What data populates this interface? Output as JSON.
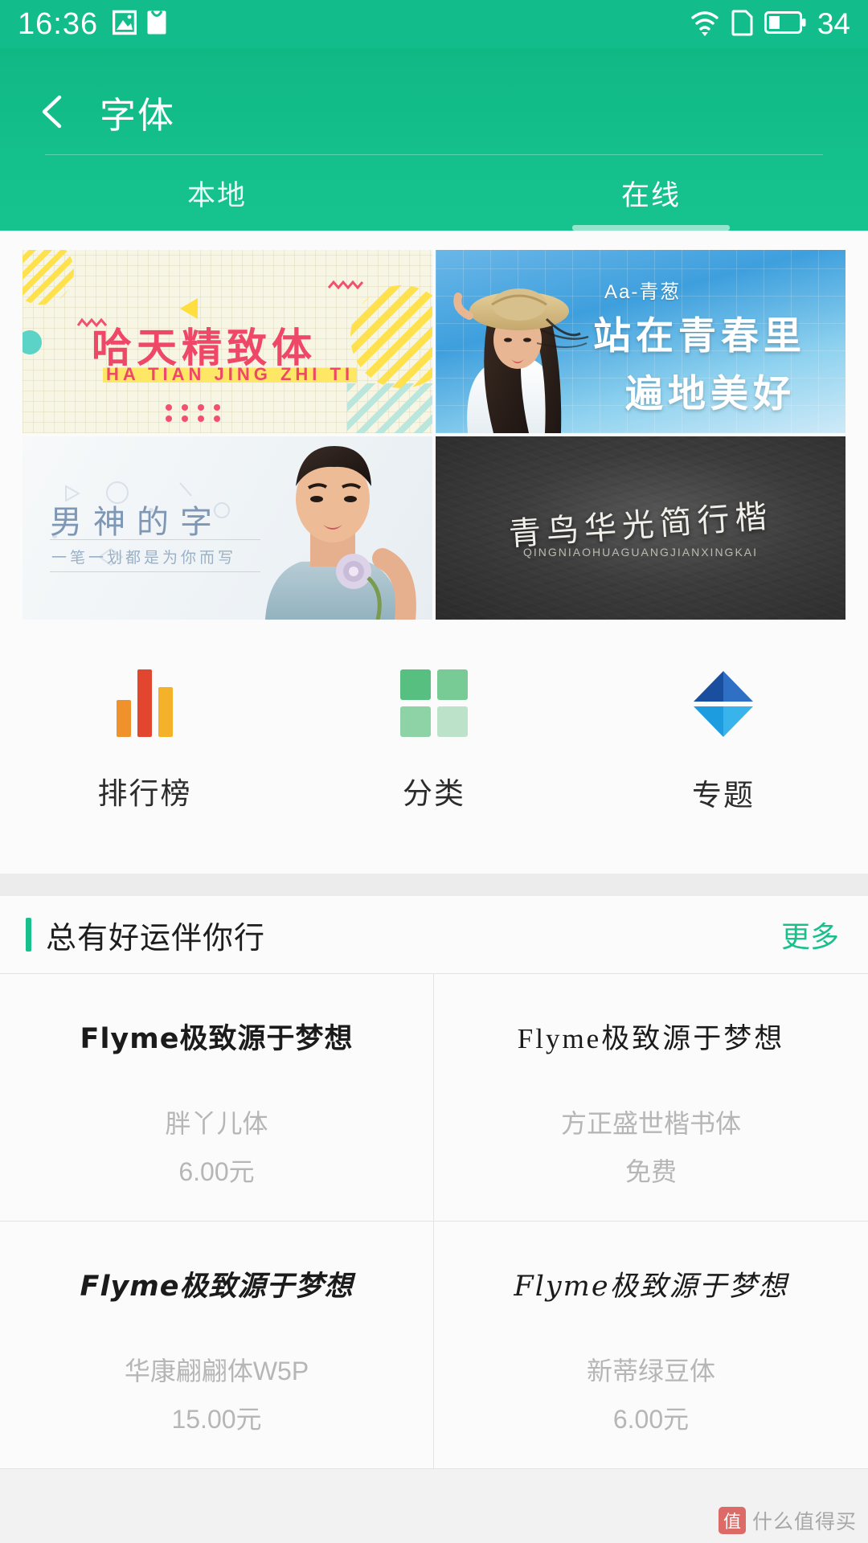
{
  "statusbar": {
    "time": "16:36",
    "icons": [
      "image-icon",
      "mail-icon",
      "wifi-icon",
      "sim-card-icon",
      "battery-icon"
    ],
    "battery_level": "34"
  },
  "header": {
    "back_icon": "back-chevron-icon",
    "title": "字体",
    "accent_color": "#14c08c",
    "tabs": [
      {
        "label": "本地",
        "active": false
      },
      {
        "label": "在线",
        "active": true
      }
    ]
  },
  "banners": [
    {
      "id": "banner-ha-tian-jing-zhi-ti",
      "title": "哈天精致体",
      "subtitle": "HA TIAN JING ZHI TI",
      "title_color": "#ef4767",
      "bg_color": "#f7f5e3"
    },
    {
      "id": "banner-aa-qing-cong",
      "eyebrow": "Aa-青葱",
      "line1": "站在青春里",
      "line2": "遍地美好",
      "bg_color": "#3e9fdd"
    },
    {
      "id": "banner-nan-shen-de-zi",
      "title": "男神的字",
      "subtitle": "一笔一划都是为你而写",
      "title_color": "#7e97b5",
      "bg_color": "#eef3f6"
    },
    {
      "id": "banner-qing-niao-hua-guang",
      "title": "青鸟华光简行楷",
      "subtitle": "QINGNIAOHUAGUANGJIANXINGKAI",
      "title_color": "#f0efe9",
      "bg_color": "#3d3d3d"
    }
  ],
  "shortcuts": [
    {
      "icon": "bar-chart-icon",
      "label": "排行榜",
      "colors": [
        "#f0922b",
        "#e2462f",
        "#f3b229"
      ]
    },
    {
      "icon": "grid-squares-icon",
      "label": "分类",
      "colors": [
        "#57bf7f",
        "#79cb96",
        "#8ed3a6",
        "#bce3c9"
      ]
    },
    {
      "icon": "diamond-icon",
      "label": "专题",
      "colors": [
        "#1a4fa0",
        "#2f6fc4",
        "#1d9ce0",
        "#38b3ec"
      ]
    }
  ],
  "section": {
    "title": "总有好运伴你行",
    "more_label": "更多",
    "accent_color": "#19c08c",
    "preview_text": "Flyme极致源于梦想",
    "fonts": [
      {
        "preview": "Flyme极致源于梦想",
        "name": "胖丫儿体",
        "price": "6.00元"
      },
      {
        "preview": "Flyme极致源于梦想",
        "name": "方正盛世楷书体",
        "price": "免费"
      },
      {
        "preview": "Flyme极致源于梦想",
        "name": "华康翩翩体W5P",
        "price": "15.00元"
      },
      {
        "preview": "Flyme极致源于梦想",
        "name": "新蒂绿豆体",
        "price": "6.00元"
      }
    ]
  },
  "watermark": {
    "mark": "值",
    "text": "什么值得买"
  }
}
